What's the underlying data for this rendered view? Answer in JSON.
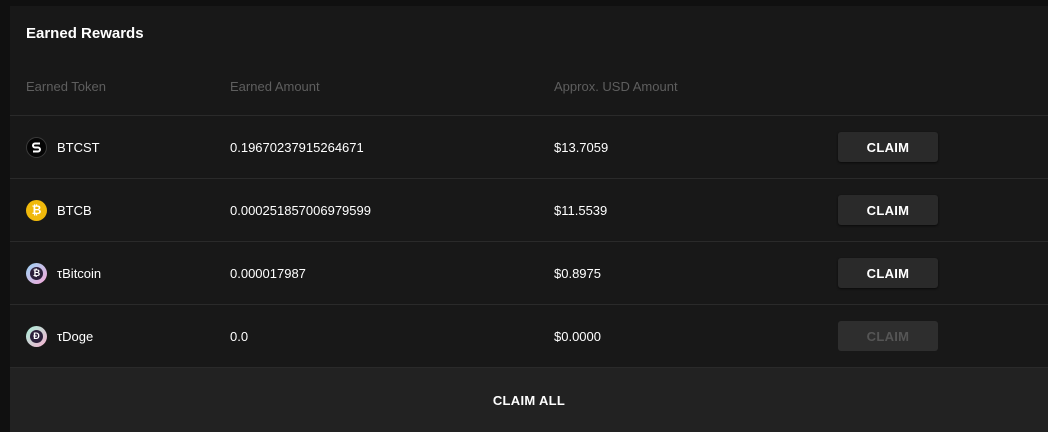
{
  "card": {
    "title": "Earned Rewards"
  },
  "table": {
    "headers": {
      "token": "Earned Token",
      "amount": "Earned Amount",
      "usd": "Approx. USD Amount"
    },
    "rows": [
      {
        "token": "BTCST",
        "icon": "btcst-token-icon",
        "amount": "0.19670237915264671",
        "usd": "$13.7059",
        "action": "CLAIM",
        "enabled": true
      },
      {
        "token": "BTCB",
        "icon": "btcb-token-icon",
        "amount": "0.000251857006979599",
        "usd": "$11.5539",
        "action": "CLAIM",
        "enabled": true
      },
      {
        "token": "τBitcoin",
        "icon": "tau-bitcoin-token-icon",
        "amount": "0.000017987",
        "usd": "$0.8975",
        "action": "CLAIM",
        "enabled": true
      },
      {
        "token": "τDoge",
        "icon": "tau-doge-token-icon",
        "amount": "0.0",
        "usd": "$0.0000",
        "action": "CLAIM",
        "enabled": false
      }
    ]
  },
  "footer": {
    "claim_all_label": "CLAIM ALL"
  },
  "colors": {
    "page_bg": "#101010",
    "card_bg": "#181818",
    "button_bg": "#2a2a2a",
    "btcb_gold": "#f0b90b"
  }
}
